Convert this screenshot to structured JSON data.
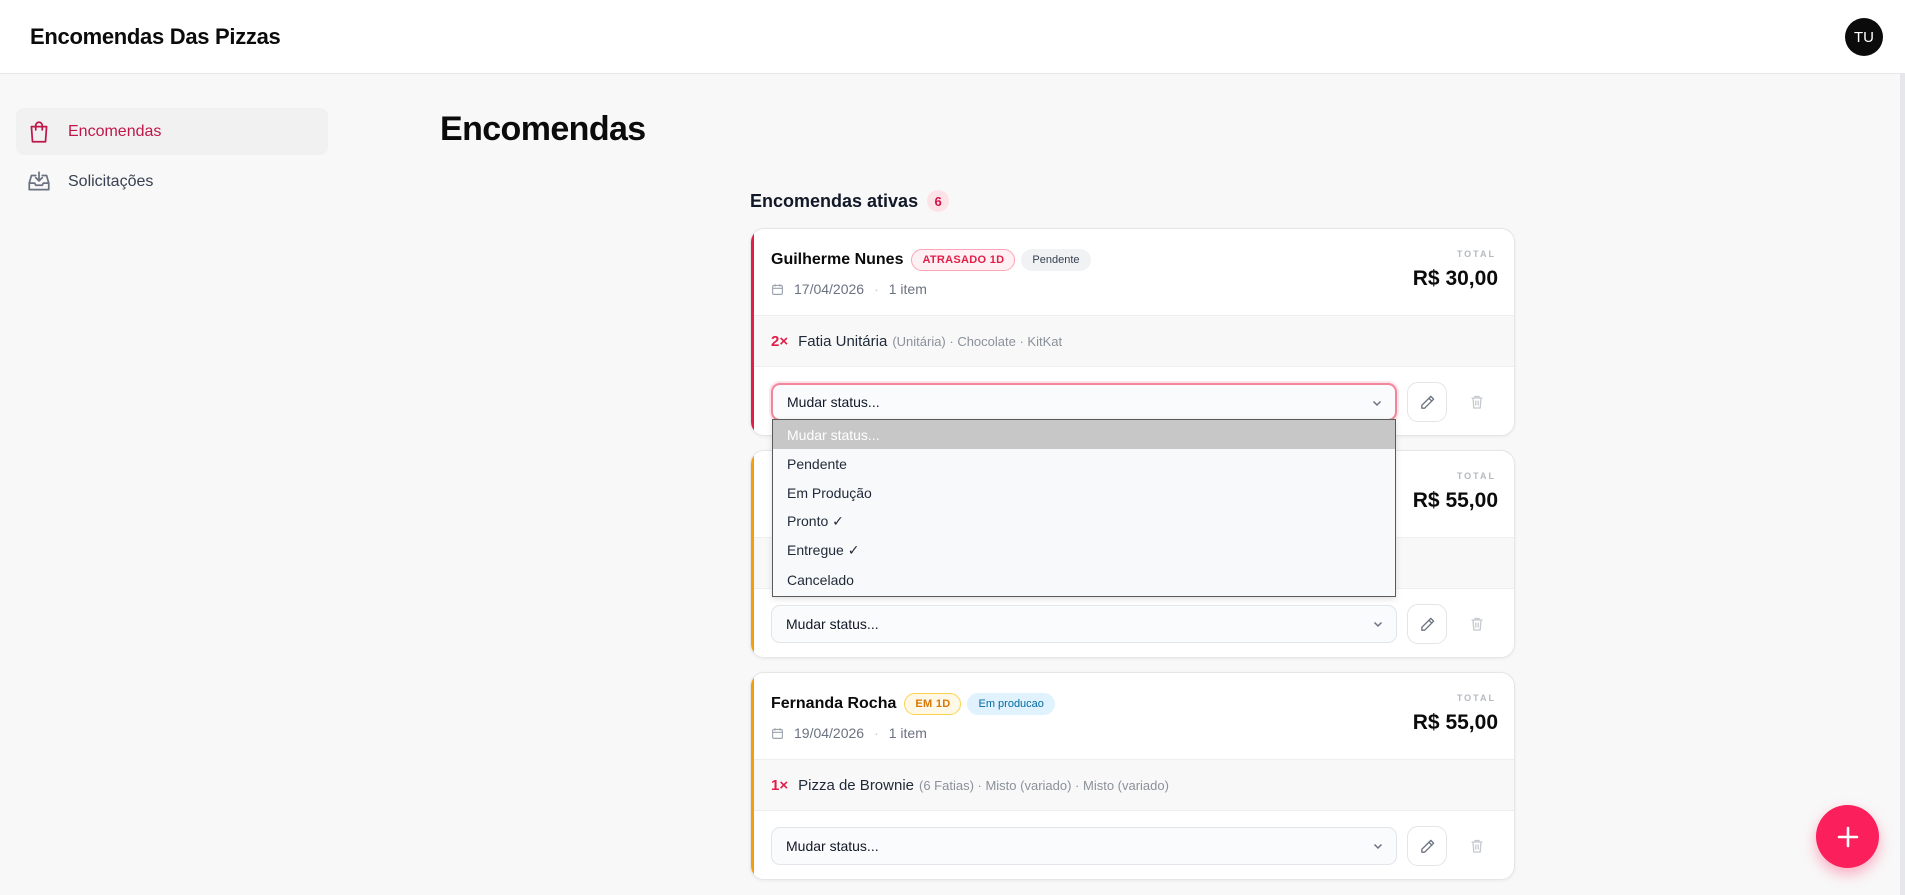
{
  "app": {
    "title": "Encomendas Das Pizzas",
    "avatar_initials": "TU"
  },
  "sidebar": {
    "items": [
      {
        "label": "Encomendas",
        "icon": "shopping-bag-icon",
        "active": true
      },
      {
        "label": "Solicitações",
        "icon": "inbox-download-icon",
        "active": false
      }
    ]
  },
  "page": {
    "title": "Encomendas"
  },
  "section": {
    "title": "Encomendas ativas",
    "count": "6"
  },
  "colors": {
    "brand": "#fb1f5b",
    "late": "#e11d48",
    "soon": "#f59e0b",
    "production": "#0369a1"
  },
  "orders": [
    {
      "customer": "Guilherme Nunes",
      "due_badge": "ATRASADO 1D",
      "status_badge": "Pendente",
      "date": "17/04/2026",
      "items_count": "1 item",
      "total_label": "TOTAL",
      "total": "R$ 30,00",
      "item": {
        "qty": "2×",
        "name": "Fatia Unitária",
        "details": "(Unitária) · Chocolate · KitKat"
      },
      "status_select": "Mudar status..."
    },
    {
      "total_label": "TOTAL",
      "total": "R$ 55,00",
      "status_select": "Mudar status..."
    },
    {
      "customer": "Fernanda Rocha",
      "due_badge": "EM 1D",
      "status_badge": "Em producao",
      "date": "19/04/2026",
      "items_count": "1 item",
      "total_label": "TOTAL",
      "total": "R$ 55,00",
      "item": {
        "qty": "1×",
        "name": "Pizza de Brownie",
        "details": "(6 Fatias) · Misto (variado) · Misto (variado)"
      },
      "status_select": "Mudar status..."
    }
  ],
  "status_dropdown": {
    "options": [
      "Mudar status...",
      "Pendente",
      "Em Produção",
      "Pronto ✓",
      "Entregue ✓",
      "Cancelado"
    ],
    "highlighted": "Mudar status..."
  },
  "fab": {
    "icon": "plus-icon"
  }
}
